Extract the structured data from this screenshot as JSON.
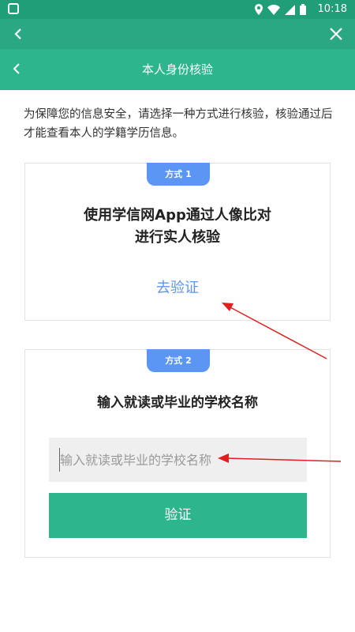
{
  "status_bar": {
    "time": "10:18"
  },
  "header": {
    "title": "本人身份核验"
  },
  "intro_text": "为保障您的信息安全，请选择一种方式进行核验，核验通过后才能查看本人的学籍学历信息。",
  "method1": {
    "badge": "方式 1",
    "heading_line1": "使用学信网App通过人像比对",
    "heading_line2": "进行实人核验",
    "link": "去验证"
  },
  "method2": {
    "badge": "方式 2",
    "heading": "输入就读或毕业的学校名称",
    "input_placeholder": "输入就读或毕业的学校名称",
    "verify_button": "验证"
  },
  "colors": {
    "status_bar": "#1f9e78",
    "top_bar": "#2aa884",
    "header": "#2db68d",
    "badge": "#5b96f5",
    "annotation_arrow": "#e02020"
  },
  "icons": [
    "app-icon",
    "location-icon",
    "wifi-icon",
    "signal-icon",
    "battery-icon",
    "back-arrow-icon",
    "close-icon"
  ]
}
